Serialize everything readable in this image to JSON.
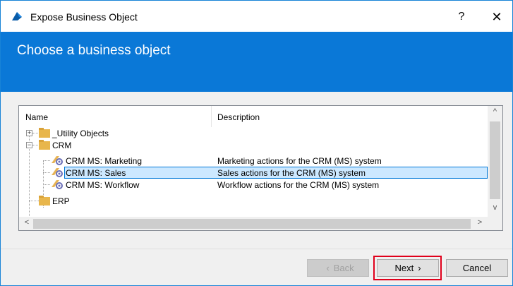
{
  "window": {
    "title": "Expose Business Object",
    "help_label": "?",
    "close_label": "✕",
    "accent": "#0a78d7"
  },
  "header": {
    "title": "Choose a business object"
  },
  "tree": {
    "columns": [
      "Name",
      "Description"
    ],
    "rows": [
      {
        "name": "_Utility Objects",
        "description": "",
        "type": "folder",
        "level": 0,
        "expander": "+"
      },
      {
        "name": "CRM",
        "description": "",
        "type": "folder",
        "level": 0,
        "expander": "−"
      },
      {
        "name": "CRM MS: Marketing",
        "description": "Marketing actions for the CRM (MS) system",
        "type": "object",
        "level": 1
      },
      {
        "name": "CRM MS: Sales",
        "description": "Sales actions for the CRM (MS) system",
        "type": "object",
        "level": 1,
        "selected": true
      },
      {
        "name": "CRM MS: Workflow",
        "description": "Workflow actions for the CRM (MS) system",
        "type": "object",
        "level": 1
      },
      {
        "name": "ERP",
        "description": "",
        "type": "folder",
        "level": 0
      }
    ],
    "scroll_up": "^",
    "scroll_down": "v",
    "scroll_left": "<",
    "scroll_right": ">"
  },
  "footer": {
    "back_label": "Back",
    "next_label": "Next",
    "cancel_label": "Cancel",
    "back_enabled": false,
    "highlight_color": "#e0001b"
  }
}
